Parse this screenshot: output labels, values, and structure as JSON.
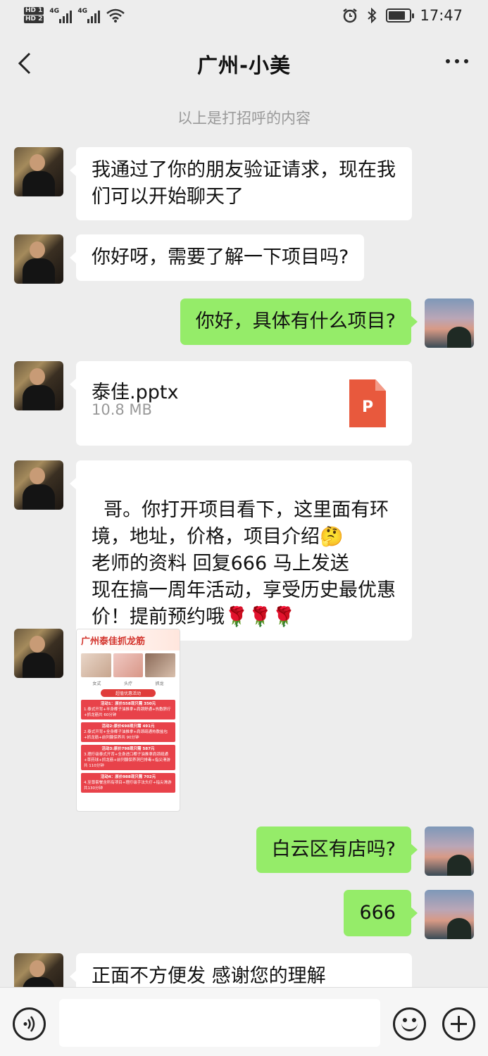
{
  "status_bar": {
    "hd1": "HD 1",
    "hd2": "HD 2",
    "net1": "4G",
    "net2": "4G",
    "time": "17:47",
    "battery_level": 0.8,
    "icons": [
      "signal-icon",
      "wifi-icon",
      "alarm-icon",
      "bluetooth-icon",
      "battery-icon"
    ]
  },
  "header": {
    "title": "广州-小美"
  },
  "system_message": "以上是打招呼的内容",
  "messages": [
    {
      "side": "left",
      "text": "我通过了你的朋友验证请求，现在我们可以开始聊天了"
    },
    {
      "side": "left",
      "text": "你好呀，需要了解一下项目吗?"
    },
    {
      "side": "right",
      "text": "你好，具体有什么项目?"
    },
    {
      "side": "left",
      "type": "file",
      "file_name": "泰佳.pptx",
      "file_size": "10.8 MB",
      "file_icon_letter": "P"
    },
    {
      "side": "left",
      "text": "哥。你打开项目看下，这里面有环境，地址，价格，项目介绍🤔\n老师的资料 回复666 马上发送\n现在搞一周年活动，享受历史最优惠价！提前预约哦🌹🌹🌹"
    },
    {
      "side": "left",
      "type": "image",
      "poster": {
        "title": "广州泰佳抓龙筋",
        "labels": [
          "女式",
          "头疗",
          "抓龙"
        ],
        "banner": "超值优惠活动",
        "blocks": [
          {
            "title": "活动1：原价558现只需 350元",
            "body": "1.泰式开背+半身椰子油推拿+肩颈舒通+热敷脐疗+抓龙筋共 60分钟"
          },
          {
            "title": "活动2:原价698现只需 491元",
            "body": "2.泰式开背+全身椰子油推拿+肩颈疏通热敷盐包+抓龙筋+前列腺保养共 90分钟"
          },
          {
            "title": "活动3:原价798现只需 587元",
            "body": "3.理疗级泰式开背+全身进口椰子油推拿肩颈疏通+草药球+抓龙筋+前列腺保养洞巴排毒+指尖滑游共 110分钟"
          },
          {
            "title": "活动4：原价988现只需 702元",
            "body": "4.至尊套餐含所有项目+理疗级手法头疗+指尖滑游 共130分钟"
          }
        ]
      }
    },
    {
      "side": "right",
      "text": "白云区有店吗?"
    },
    {
      "side": "right",
      "text": "666"
    },
    {
      "side": "left",
      "text": "正面不方便发 感谢您的理解"
    }
  ],
  "input_bar": {
    "placeholder": "",
    "value": ""
  },
  "colors": {
    "background": "#ededed",
    "bubble_self": "#95ec69",
    "bubble_other": "#ffffff",
    "ppt_icon": "#e8593d"
  }
}
